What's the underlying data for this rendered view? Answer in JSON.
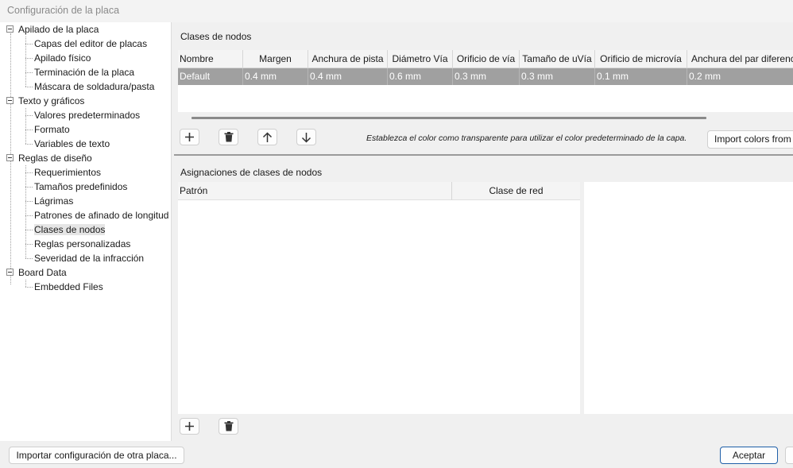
{
  "window": {
    "title": "Configuración de la placa"
  },
  "tree": {
    "groups": [
      {
        "label": "Apilado de la placa",
        "children": [
          "Capas del editor de placas",
          "Apilado físico",
          "Terminación de la placa",
          "Máscara de soldadura/pasta"
        ]
      },
      {
        "label": "Texto y gráficos",
        "children": [
          "Valores predeterminados",
          "Formato",
          "Variables de texto"
        ]
      },
      {
        "label": "Reglas de diseño",
        "children": [
          "Requerimientos",
          "Tamaños predefinidos",
          "Lágrimas",
          "Patrones de afinado de longitud",
          "Clases de nodos",
          "Reglas personalizadas",
          "Severidad de la infracción"
        ]
      },
      {
        "label": "Board Data",
        "children": [
          "Embedded Files"
        ]
      }
    ],
    "selected": "Clases de nodos"
  },
  "net_classes": {
    "title": "Clases de nodos",
    "columns": [
      "Nombre",
      "Margen",
      "Anchura de pista",
      "Diámetro Vía",
      "Orificio de vía",
      "Tamaño de uVía",
      "Orificio de microvía",
      "Anchura del par diferencial"
    ],
    "rows": [
      [
        "Default",
        "0.4 mm",
        "0.4 mm",
        "0.6 mm",
        "0.3 mm",
        "0.3 mm",
        "0.1 mm",
        "0.2 mm"
      ]
    ],
    "toolbar_icons": [
      "add-icon",
      "delete-icon",
      "move-up-icon",
      "move-down-icon"
    ],
    "hint": "Establezca el color como transparente para utilizar el color predeterminado de la capa.",
    "import_colors_label": "Import colors from"
  },
  "assignments": {
    "title": "Asignaciones de clases de nodos",
    "columns": [
      "Patrón",
      "Clase de red"
    ],
    "toolbar_icons": [
      "add-icon",
      "delete-icon"
    ]
  },
  "footer": {
    "import_settings_label": "Importar configuración de otra placa...",
    "accept_label": "Aceptar"
  }
}
